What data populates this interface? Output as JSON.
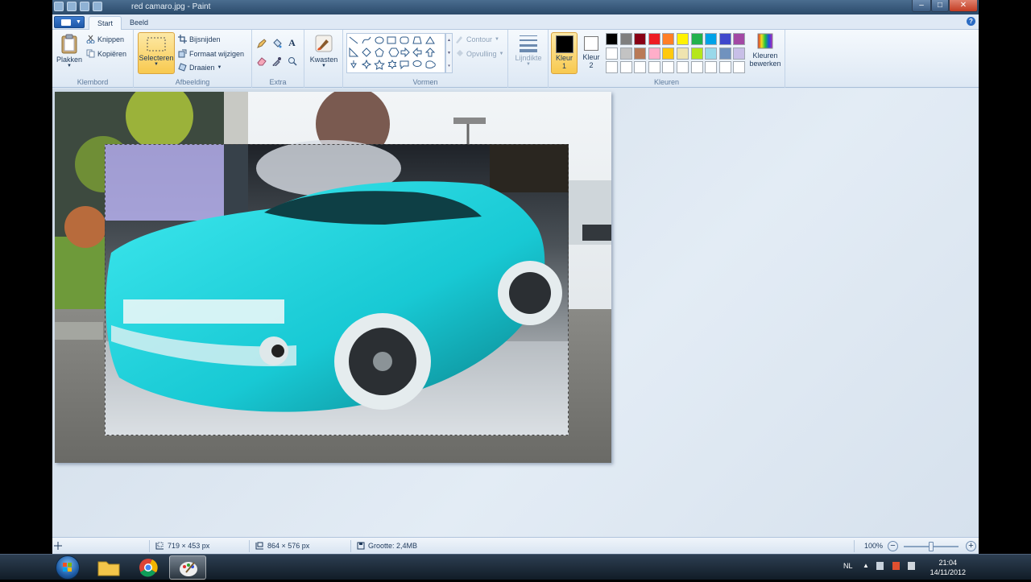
{
  "window": {
    "title": "red camaro.jpg - Paint",
    "min_glyph": "–",
    "max_glyph": "□",
    "close_glyph": "✕"
  },
  "tabs": [
    {
      "label": "Start"
    },
    {
      "label": "Beeld"
    }
  ],
  "help_glyph": "?",
  "ribbon": {
    "klembord": {
      "label": "Klembord",
      "paste": "Plakken",
      "cut": "Knippen",
      "copy": "Kopiëren"
    },
    "afbeelding": {
      "label": "Afbeelding",
      "select": "Selecteren",
      "crop": "Bijsnijden",
      "resize": "Formaat wijzigen",
      "rotate": "Draaien"
    },
    "extra": {
      "label": "Extra"
    },
    "kwasten": {
      "label": "Kwasten"
    },
    "vormen": {
      "label": "Vormen",
      "outline": "Contour",
      "fill": "Opvulling"
    },
    "line_width": {
      "label": "Lijndikte"
    },
    "kleuren": {
      "label": "Kleuren",
      "color1": {
        "label": "Kleur",
        "num": "1",
        "color": "#000000"
      },
      "color2": {
        "label": "Kleur",
        "num": "2",
        "color": "#ffffff"
      },
      "edit": {
        "line1": "Kleuren",
        "line2": "bewerken"
      },
      "palette_row1": [
        "#000000",
        "#7f7f7f",
        "#880015",
        "#ed1c24",
        "#ff7f27",
        "#fff200",
        "#22b14c",
        "#00a2e8",
        "#3f48cc",
        "#a349a4"
      ],
      "palette_row2": [
        "#ffffff",
        "#c3c3c3",
        "#b97a57",
        "#ffaec9",
        "#ffc90e",
        "#efe4b0",
        "#b5e61d",
        "#99d9ea",
        "#7092be",
        "#c8bfe7"
      ]
    }
  },
  "status": {
    "selection_size": "719 × 453 px",
    "image_size": "864 × 576 px",
    "file_size": "Grootte: 2,4MB",
    "zoom": "100%",
    "zoom_level": 0.5
  },
  "taskbar": {
    "lang": "NL",
    "time": "21:04",
    "date": "14/11/2012"
  }
}
